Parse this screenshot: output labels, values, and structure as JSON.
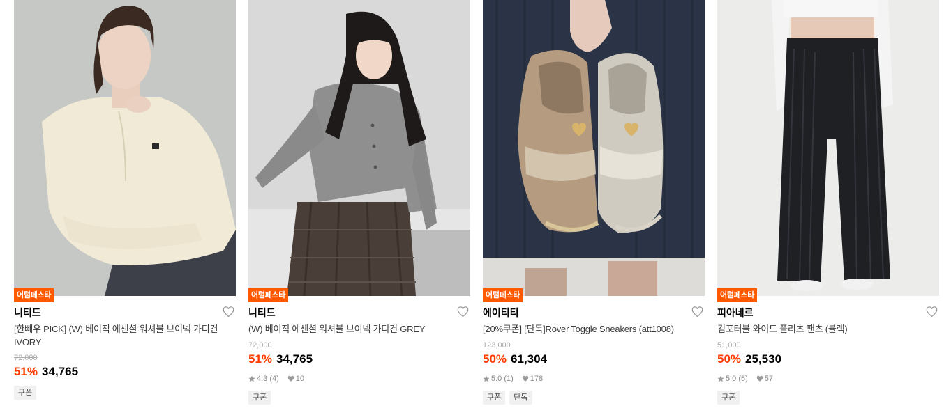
{
  "colors": {
    "accent": "#ff5a00",
    "discount": "#ff3b00",
    "muted": "#aaaaaa"
  },
  "products": [
    {
      "badge": "어텀페스타",
      "brand": "니티드",
      "name": "[한빼우 PICK] (W) 베이직 에센셜 워셔블 브이넥 가디건 IVORY",
      "original_price": "72,000",
      "discount": "51%",
      "price": "34,765",
      "rating": "",
      "likes": "",
      "tags": [
        "쿠폰"
      ]
    },
    {
      "badge": "어텀페스타",
      "brand": "니티드",
      "name": "(W) 베이직 에센셜 워셔블 브이넥 가디건 GREY",
      "original_price": "72,000",
      "discount": "51%",
      "price": "34,765",
      "rating": "4.3 (4)",
      "likes": "10",
      "tags": [
        "쿠폰"
      ]
    },
    {
      "badge": "어텀페스타",
      "brand": "에이티티",
      "name": "[20%쿠폰] [단독]Rover Toggle Sneakers (att1008)",
      "original_price": "123,000",
      "discount": "50%",
      "price": "61,304",
      "rating": "5.0 (1)",
      "likes": "178",
      "tags": [
        "쿠폰",
        "단독"
      ]
    },
    {
      "badge": "어텀페스타",
      "brand": "피아네르",
      "name": "컴포터블 와이드 플리츠 팬츠 (블랙)",
      "original_price": "51,000",
      "discount": "50%",
      "price": "25,530",
      "rating": "5.0 (5)",
      "likes": "57",
      "tags": [
        "쿠폰"
      ]
    }
  ]
}
